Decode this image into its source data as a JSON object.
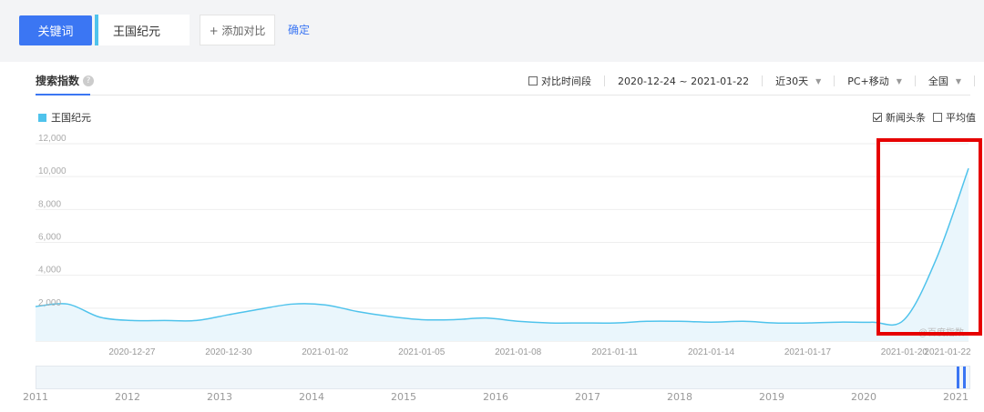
{
  "toolbar": {
    "keyword_button": "关键词",
    "keyword_value": "王国纪元",
    "add_compare": "+ 添加对比",
    "confirm": "确定"
  },
  "panel": {
    "title": "搜索指数",
    "help_icon": "?",
    "controls": {
      "compare_period": "对比时间段",
      "date_range": "2020-12-24 ~ 2021-01-22",
      "period_select": "近30天",
      "device_select": "PC+移动",
      "region_select": "全国"
    },
    "legend_label": "王国纪元",
    "news_headlines": "新闻头条",
    "average": "平均值",
    "watermark": "@百度指数"
  },
  "chart_data": {
    "type": "area",
    "series": [
      {
        "name": "王国纪元",
        "color": "#4fc3ec",
        "x": [
          "2020-12-24",
          "2020-12-25",
          "2020-12-26",
          "2020-12-27",
          "2020-12-28",
          "2020-12-29",
          "2020-12-30",
          "2020-12-31",
          "2021-01-01",
          "2021-01-02",
          "2021-01-03",
          "2021-01-04",
          "2021-01-05",
          "2021-01-06",
          "2021-01-07",
          "2021-01-08",
          "2021-01-09",
          "2021-01-10",
          "2021-01-11",
          "2021-01-12",
          "2021-01-13",
          "2021-01-14",
          "2021-01-15",
          "2021-01-16",
          "2021-01-17",
          "2021-01-18",
          "2021-01-19",
          "2021-01-20",
          "2021-01-21",
          "2021-01-22"
        ],
        "values": [
          2100,
          2250,
          1450,
          1250,
          1250,
          1250,
          1600,
          1950,
          2250,
          2200,
          1800,
          1500,
          1300,
          1300,
          1400,
          1200,
          1100,
          1100,
          1100,
          1200,
          1200,
          1150,
          1200,
          1100,
          1100,
          1150,
          1150,
          1300,
          5000,
          10500
        ]
      }
    ],
    "x_tick_labels": [
      "2020-12-27",
      "2020-12-30",
      "2021-01-02",
      "2021-01-05",
      "2021-01-08",
      "2021-01-11",
      "2021-01-14",
      "2021-01-17",
      "2021-01-20",
      "2021-01-22"
    ],
    "y_tick_labels": [
      "2,000",
      "4,000",
      "6,000",
      "8,000",
      "10,000",
      "12,000"
    ],
    "ylim": [
      0,
      12000
    ],
    "grid": true,
    "legend": "top-left"
  },
  "navigator": {
    "years": [
      "2011",
      "2012",
      "2013",
      "2014",
      "2015",
      "2016",
      "2017",
      "2018",
      "2019",
      "2020",
      "2021"
    ]
  },
  "highlight_color": "#e60000"
}
